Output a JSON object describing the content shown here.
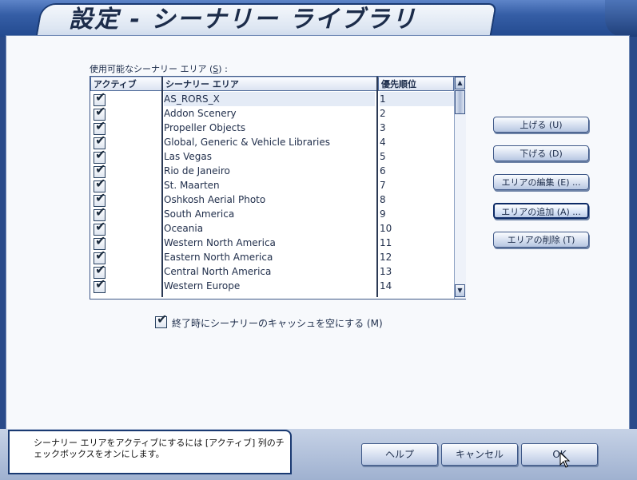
{
  "window": {
    "title": "設定 - シーナリー ライブラリ"
  },
  "list": {
    "label": "使用可能なシーナリー エリア (",
    "label_key": "S",
    "label_end": ") :",
    "columns": [
      "アクティブ",
      "シーナリー エリア",
      "優先順位"
    ],
    "rows": [
      {
        "active": true,
        "name": "AS_RORS_X",
        "priority": "1"
      },
      {
        "active": true,
        "name": "Addon Scenery",
        "priority": "2"
      },
      {
        "active": true,
        "name": "Propeller Objects",
        "priority": "3"
      },
      {
        "active": true,
        "name": "Global, Generic & Vehicle Libraries",
        "priority": "4"
      },
      {
        "active": true,
        "name": "Las Vegas",
        "priority": "5"
      },
      {
        "active": true,
        "name": "Rio de Janeiro",
        "priority": "6"
      },
      {
        "active": true,
        "name": "St. Maarten",
        "priority": "7"
      },
      {
        "active": true,
        "name": "Oshkosh Aerial Photo",
        "priority": "8"
      },
      {
        "active": true,
        "name": "South America",
        "priority": "9"
      },
      {
        "active": true,
        "name": "Oceania",
        "priority": "10"
      },
      {
        "active": true,
        "name": "Western North America",
        "priority": "11"
      },
      {
        "active": true,
        "name": "Eastern North America",
        "priority": "12"
      },
      {
        "active": true,
        "name": "Central North America",
        "priority": "13"
      },
      {
        "active": true,
        "name": "Western Europe",
        "priority": "14"
      }
    ]
  },
  "side_buttons": {
    "move_up": "上げる (U)",
    "move_down": "下げる (D)",
    "edit_area": "エリアの編集 (E) ...",
    "add_area": "エリアの追加 (A) ...",
    "delete_area": "エリアの削除 (T)"
  },
  "clear_cache": {
    "checked": true,
    "label": "終了時にシーナリーのキャッシュを空にする (M)"
  },
  "hint": {
    "text": "シーナリー エリアをアクティブにするには [アクティブ] 列のチェックボックスをオンにします。"
  },
  "footer": {
    "help": "ヘルプ",
    "cancel": "キャンセル",
    "ok": "OK"
  },
  "icons": {
    "check": "check-icon",
    "scroll_up": "arrow-up-icon",
    "scroll_down": "arrow-down-icon",
    "cursor": "mouse-pointer-icon"
  },
  "colors": {
    "frame": "#2a4b8a",
    "panel": "#f7f9fc",
    "text": "#1c2c4a"
  }
}
